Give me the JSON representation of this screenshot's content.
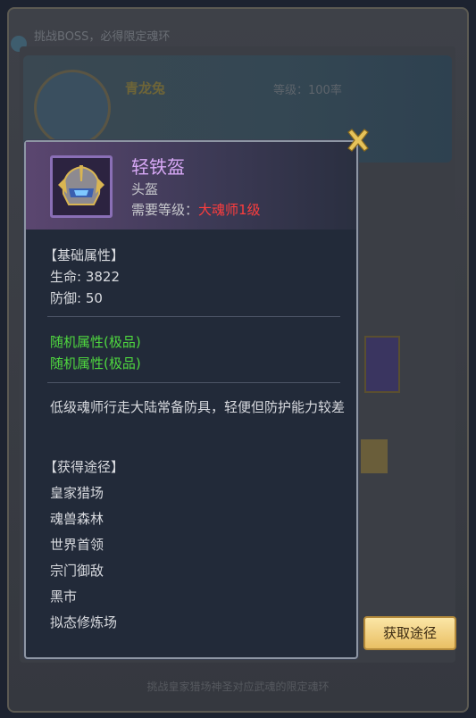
{
  "background": {
    "header": "挑战BOSS，必得限定魂环",
    "boss_name": "青龙兔",
    "level_text": "等级：100率",
    "footer": "挑战皇家猎场神圣对应武魂的限定魂环"
  },
  "tooltip": {
    "item_name": "轻铁盔",
    "item_type": "头盔",
    "req_label": "需要等级：",
    "req_value": "大魂师1级",
    "base_header": "【基础属性】",
    "stats": [
      "生命: 3822",
      "防御: 50"
    ],
    "random_attrs": [
      "随机属性(极品)",
      "随机属性(极品)"
    ],
    "description": "低级魂师行走大陆常备防具，轻便但防护能力较差",
    "source_header": "【获得途径】",
    "sources": [
      "皇家猎场",
      "魂兽森林",
      "世界首领",
      "宗门御敌",
      "黑市",
      "拟态修炼场"
    ]
  },
  "source_button": "获取途径",
  "colors": {
    "item_name": "#d7a8f5",
    "requirement_red": "#ff3d3d",
    "header_gold": "#e7c06a",
    "random_green": "#4fd83f",
    "button_gold": "#e9bf64"
  },
  "icons": {
    "close": "close-icon",
    "item": "helmet-icon"
  }
}
